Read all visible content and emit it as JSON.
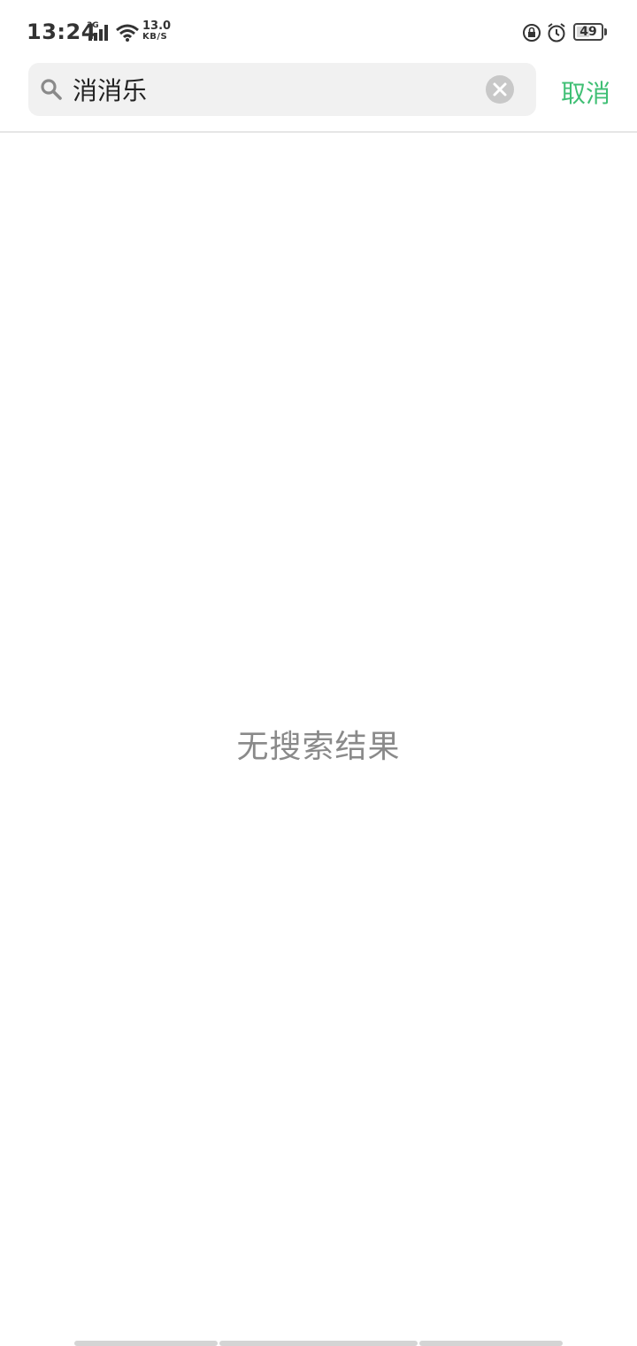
{
  "status_bar": {
    "time": "13:24",
    "network": "3G",
    "speed_value": "13.0",
    "speed_unit": "KB/S",
    "battery": "49",
    "icons": [
      "signal-icon",
      "wifi-icon",
      "rotation-lock-icon",
      "alarm-icon",
      "battery-icon"
    ]
  },
  "search": {
    "query": "消消乐",
    "cancel_label": "取消",
    "icon": "search-icon",
    "clear_icon": "clear-icon"
  },
  "results": {
    "empty_text": "无搜索结果"
  },
  "colors": {
    "accent": "#3fbf74",
    "search_bg": "#f1f1f1",
    "empty_text": "#8a8a8a"
  }
}
